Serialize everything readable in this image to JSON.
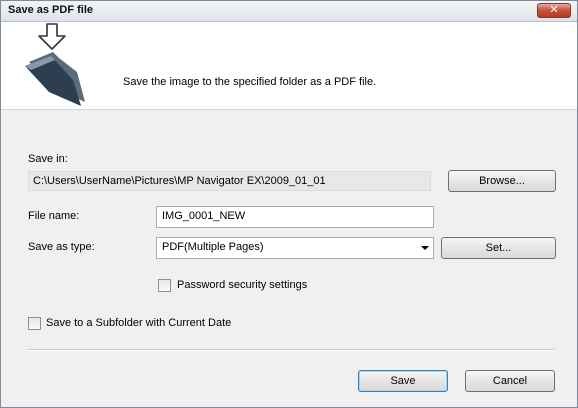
{
  "window": {
    "title": "Save as PDF file",
    "close_label": "✕"
  },
  "header": {
    "icon": "save-folder-arrow-icon",
    "description": "Save the image to the specified folder as a PDF file."
  },
  "form": {
    "save_in_label": "Save in:",
    "save_in_path": "C:\\Users\\UserName\\Pictures\\MP Navigator EX\\2009_01_01",
    "browse_label": "Browse...",
    "file_name_label": "File name:",
    "file_name_value": "IMG_0001_NEW",
    "save_as_type_label": "Save as type:",
    "save_as_type_value": "PDF(Multiple Pages)",
    "set_label": "Set...",
    "password_security_label": "Password security settings",
    "password_security_checked": false,
    "subfolder_label": "Save to a Subfolder with Current Date",
    "subfolder_checked": false
  },
  "footer": {
    "save_label": "Save",
    "cancel_label": "Cancel"
  }
}
